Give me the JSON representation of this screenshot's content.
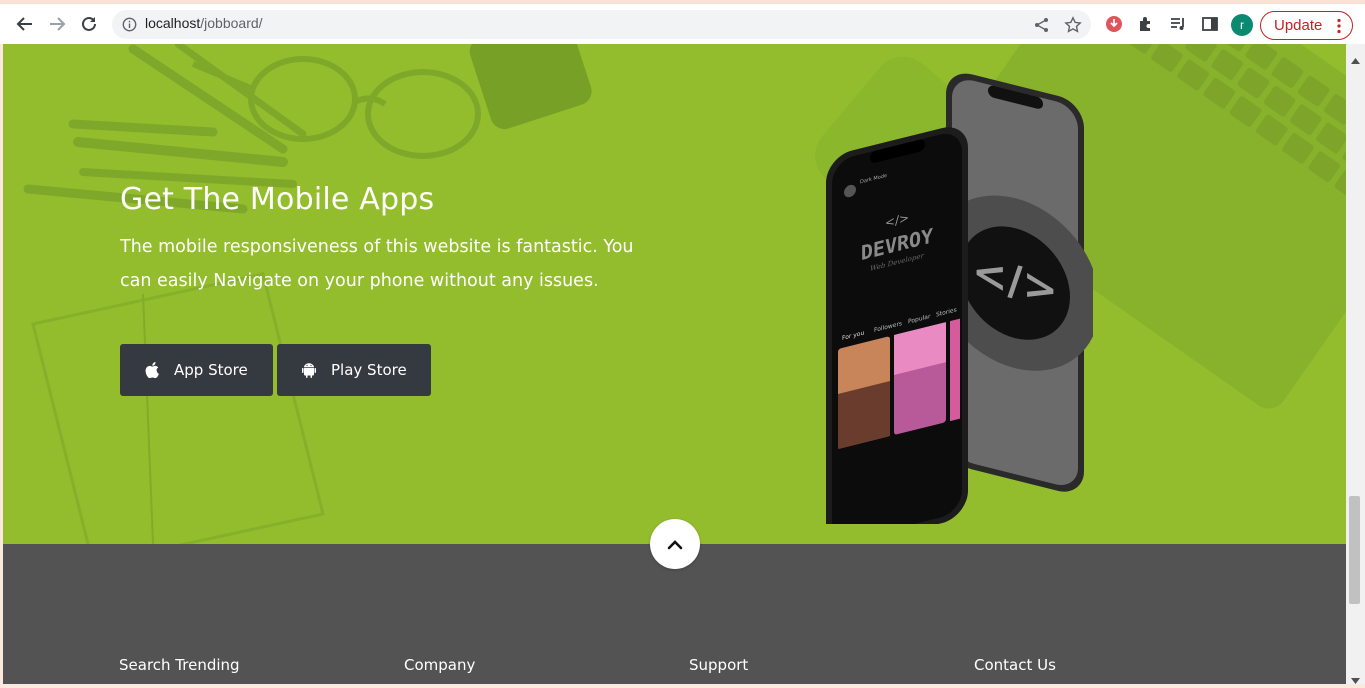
{
  "browser": {
    "url_host": "localhost",
    "url_path": "/jobboard/",
    "update_label": "Update",
    "avatar_letter": "r"
  },
  "hero": {
    "title": "Get The Mobile Apps",
    "text": "The mobile responsiveness of this website is fantastic. You can easily Navigate on your phone without any issues.",
    "bg_color": "#93bd2d",
    "buttons": {
      "app_store": "App Store",
      "play_store": "Play Store"
    },
    "phone_screen": {
      "brand": "DEVROY",
      "subtitle": "Web Developer",
      "tabs": [
        "For you",
        "Followers",
        "Popular",
        "Stories"
      ]
    }
  },
  "footer": {
    "bg_color": "#535353",
    "columns": [
      "Search Trending",
      "Company",
      "Support",
      "Contact Us"
    ]
  },
  "colors": {
    "button_bg": "#343a40",
    "update_red": "#c5221f",
    "avatar_green": "#0b8a72"
  }
}
